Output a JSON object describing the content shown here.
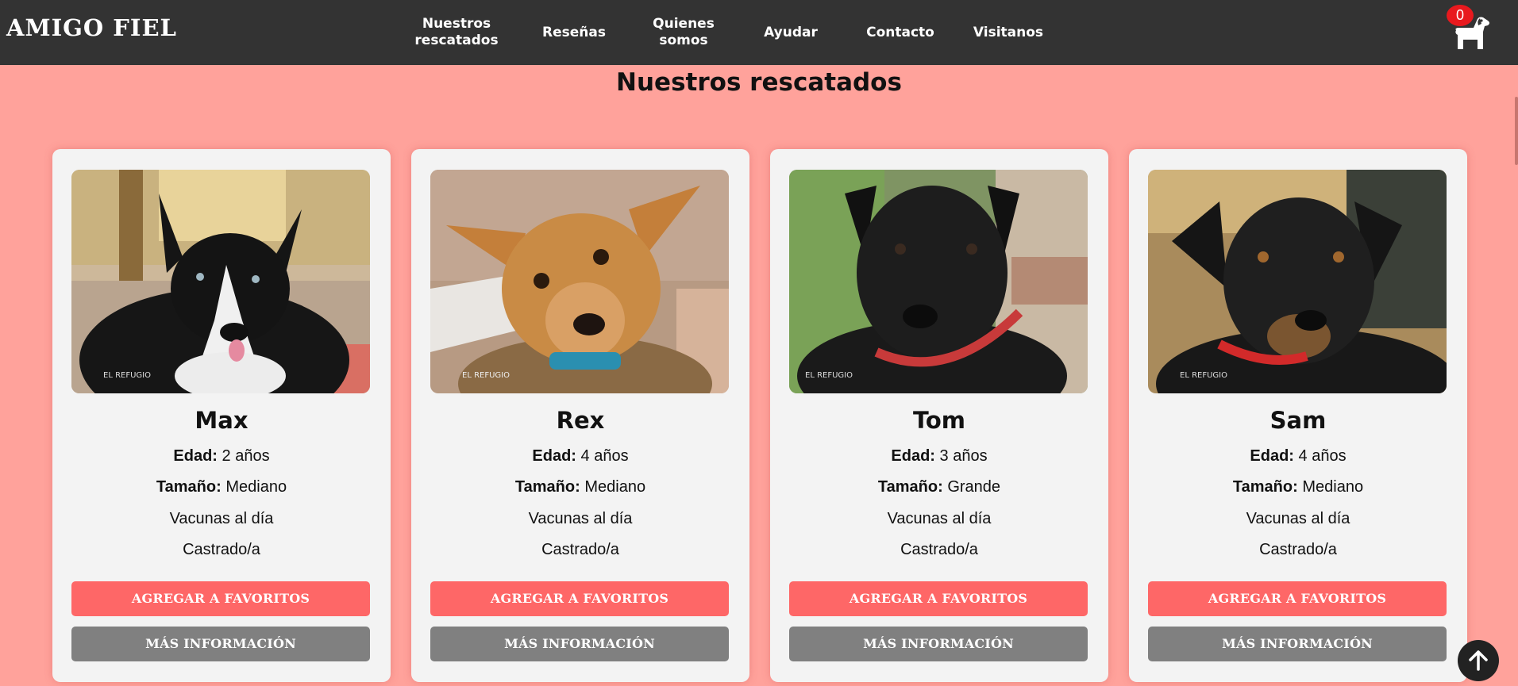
{
  "nav": {
    "logo": "AMIGO FIEL",
    "links": [
      "Nuestros\nrescatados",
      "Reseñas",
      "Quienes\nsomos",
      "Ayudar",
      "Contacto",
      "Visitanos"
    ],
    "cart_count": "0",
    "cart_icon": "dog-cart-icon"
  },
  "page": {
    "title": "Nuestros rescatados"
  },
  "pets": [
    {
      "name": "Max",
      "edad_label": "Edad:",
      "edad": "2 años",
      "tamano_label": "Tamaño:",
      "tamano": "Mediano",
      "vacunas": "Vacunas al día",
      "castrado": "Castrado/a",
      "fav": "AGREGAR A FAVORITOS",
      "info": "MÁS INFORMACIÓN",
      "photo": "black-white-dog-photo"
    },
    {
      "name": "Rex",
      "edad_label": "Edad:",
      "edad": "4 años",
      "tamano_label": "Tamaño:",
      "tamano": "Mediano",
      "vacunas": "Vacunas al día",
      "castrado": "Castrado/a",
      "fav": "AGREGAR A FAVORITOS",
      "info": "MÁS INFORMACIÓN",
      "photo": "tan-dog-photo"
    },
    {
      "name": "Tom",
      "edad_label": "Edad:",
      "edad": "3 años",
      "tamano_label": "Tamaño:",
      "tamano": "Grande",
      "vacunas": "Vacunas al día",
      "castrado": "Castrado/a",
      "fav": "AGREGAR A FAVORITOS",
      "info": "MÁS INFORMACIÓN",
      "photo": "black-dog-photo"
    },
    {
      "name": "Sam",
      "edad_label": "Edad:",
      "edad": "4 años",
      "tamano_label": "Tamaño:",
      "tamano": "Mediano",
      "vacunas": "Vacunas al día",
      "castrado": "Castrado/a",
      "fav": "AGREGAR A FAVORITOS",
      "info": "MÁS INFORMACIÓN",
      "photo": "black-tan-dog-photo"
    }
  ],
  "colors": {
    "nav_bg": "#333333",
    "page_bg": "#ffa29b",
    "fav_button": "#fe6767",
    "info_button": "#808080",
    "badge": "#e8191e"
  },
  "scroll_top_icon": "arrow-up-icon"
}
